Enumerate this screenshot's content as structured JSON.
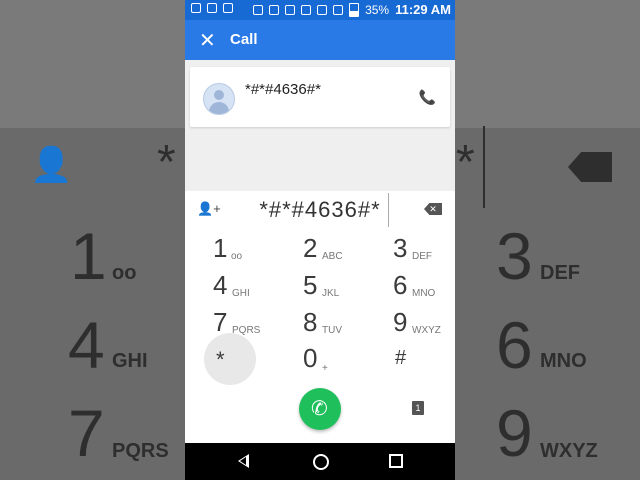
{
  "status_bar": {
    "battery": "35%",
    "time": "11:29 AM"
  },
  "app_bar": {
    "close_icon": "close-icon",
    "title": "Call"
  },
  "suggestion": {
    "number": "*#*#4636#*",
    "call_icon": "phone-icon"
  },
  "entry": {
    "digits": "*#*#4636#*"
  },
  "keypad": {
    "keys": [
      {
        "digit": "1",
        "sub": "oo"
      },
      {
        "digit": "2",
        "sub": "ABC"
      },
      {
        "digit": "3",
        "sub": "DEF"
      },
      {
        "digit": "4",
        "sub": "GHI"
      },
      {
        "digit": "5",
        "sub": "JKL"
      },
      {
        "digit": "6",
        "sub": "MNO"
      },
      {
        "digit": "7",
        "sub": "PQRS"
      },
      {
        "digit": "8",
        "sub": "TUV"
      },
      {
        "digit": "9",
        "sub": "WXYZ"
      },
      {
        "digit": "*",
        "sub": ""
      },
      {
        "digit": "0",
        "sub": "+"
      },
      {
        "digit": "#",
        "sub": ""
      }
    ]
  },
  "background": {
    "entry_digits_partial_left": "*",
    "entry_digits_partial_right": "*",
    "keys": [
      {
        "digit": "1",
        "sub": "oo"
      },
      {
        "digit": "3",
        "sub": "DEF"
      },
      {
        "digit": "4",
        "sub": "GHI"
      },
      {
        "digit": "6",
        "sub": "MNO"
      },
      {
        "digit": "7",
        "sub": "PQRS"
      },
      {
        "digit": "9",
        "sub": "WXYZ"
      }
    ]
  },
  "colors": {
    "status_bar": "#1769d3",
    "app_bar": "#2979e6",
    "dial_button": "#1fbf5c"
  }
}
